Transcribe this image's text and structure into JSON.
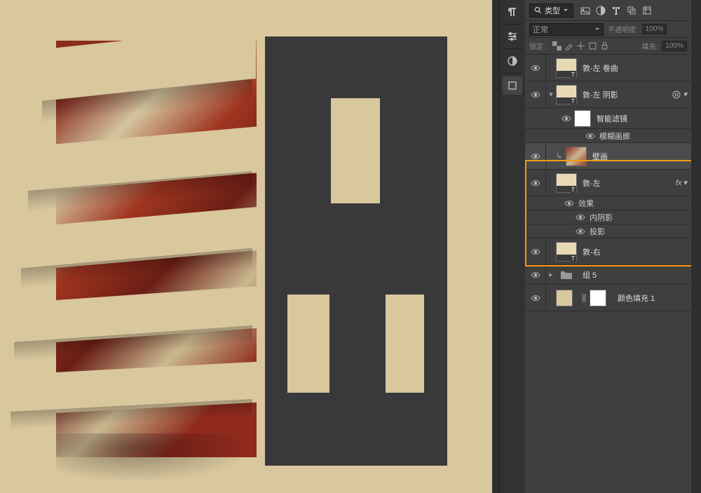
{
  "filter": {
    "label": "类型"
  },
  "blend": {
    "mode": "正常"
  },
  "opacity": {
    "label": "不透明度:",
    "value": "100%"
  },
  "fill": {
    "label": "填充:",
    "value": "100%"
  },
  "lock": {
    "label": "锁定:"
  },
  "layers": {
    "l1": {
      "name": "敦-左 卷曲"
    },
    "l2": {
      "name": "敦-左 阴影"
    },
    "l2_filter": {
      "name": "智能滤镜"
    },
    "l2_blur": {
      "name": "模糊画廊"
    },
    "l3": {
      "name": "壁画"
    },
    "l4": {
      "name": "敦-左"
    },
    "l4_fx": {
      "label": "效果"
    },
    "l4_inner": {
      "label": "内阴影"
    },
    "l4_drop": {
      "label": "投影"
    },
    "l5": {
      "name": "敦-右"
    },
    "l6": {
      "name": "组 5"
    },
    "l7": {
      "name": "颜色填充 1"
    }
  },
  "fx_label": "fx"
}
